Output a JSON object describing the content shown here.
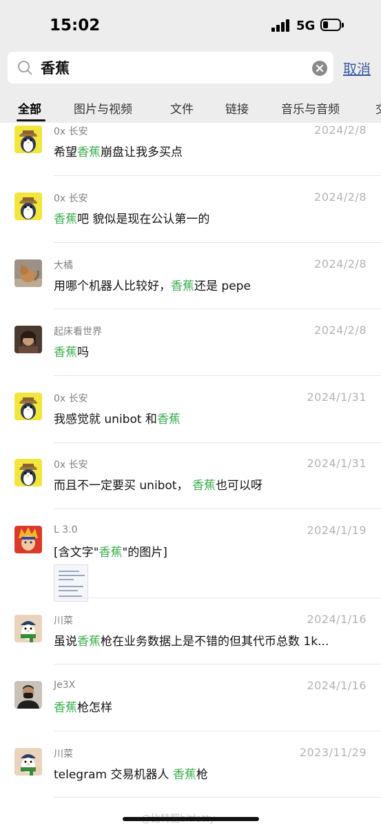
{
  "status_bar": {
    "time": "15:02",
    "network": "5G",
    "battery_level": 0.3
  },
  "search": {
    "query": "香蕉",
    "cancel_label": "取消"
  },
  "tabs": [
    {
      "label": "全部",
      "active": true
    },
    {
      "label": "图片与视频",
      "active": false
    },
    {
      "label": "文件",
      "active": false
    },
    {
      "label": "链接",
      "active": false
    },
    {
      "label": "音乐与音频",
      "active": false
    },
    {
      "label": "交",
      "active": false
    }
  ],
  "results": [
    {
      "sender": "0x 长安",
      "date": "2024/2/8",
      "avatar": "penguin-yellow-icon",
      "parts": [
        [
          "希望",
          false
        ],
        [
          "香蕉",
          true
        ],
        [
          "崩盘让我多买点",
          false
        ]
      ]
    },
    {
      "sender": "0x 长安",
      "date": "2024/2/8",
      "avatar": "penguin-yellow-icon",
      "parts": [
        [
          "香蕉",
          true
        ],
        [
          "吧 貌似是现在公认第一的",
          false
        ]
      ]
    },
    {
      "sender": "大橘",
      "date": "2024/2/8",
      "avatar": "cat-photo-icon",
      "parts": [
        [
          "用哪个机器人比较好，",
          false
        ],
        [
          "香蕉",
          true
        ],
        [
          "还是 pepe",
          false
        ]
      ]
    },
    {
      "sender": "起床看世界",
      "date": "2024/2/8",
      "avatar": "portrait-photo-icon",
      "parts": [
        [
          "香蕉",
          true
        ],
        [
          "吗",
          false
        ]
      ]
    },
    {
      "sender": "0x 长安",
      "date": "2024/1/31",
      "avatar": "penguin-yellow-icon",
      "parts": [
        [
          "我感觉就 unibot 和",
          false
        ],
        [
          "香蕉",
          true
        ]
      ]
    },
    {
      "sender": "0x 长安",
      "date": "2024/1/31",
      "avatar": "penguin-yellow-icon",
      "parts": [
        [
          "而且不一定要买 unibot，  ",
          false
        ],
        [
          "香蕉",
          true
        ],
        [
          "也可以呀",
          false
        ]
      ]
    },
    {
      "sender": "L 3.0",
      "date": "2024/1/19",
      "avatar": "anime-character-icon",
      "parts": [
        [
          "[含文字\"",
          false
        ],
        [
          "香蕉",
          true
        ],
        [
          "\"的图片]",
          false
        ]
      ],
      "has_image": true
    },
    {
      "sender": "川菜",
      "date": "2024/1/16",
      "avatar": "penguin-scarf-icon",
      "parts": [
        [
          "虽说",
          false
        ],
        [
          "香蕉",
          true
        ],
        [
          "枪在业务数据上是不错的但其代币总数 1k...",
          false
        ]
      ]
    },
    {
      "sender": "Je3X",
      "date": "2024/1/16",
      "avatar": "person-masked-icon",
      "parts": [
        [
          "香蕉",
          true
        ],
        [
          "枪怎样",
          false
        ]
      ]
    },
    {
      "sender": "川菜",
      "date": "2023/11/29",
      "avatar": "penguin-scarf-icon",
      "parts": [
        [
          "telegram 交易机器人 ",
          false
        ],
        [
          "香蕉",
          true
        ],
        [
          "枪",
          false
        ]
      ]
    }
  ],
  "watermark": "@比特肥bitfatty",
  "colors": {
    "highlight": "#3dad4f",
    "link": "#3a5b9f",
    "header_bg": "#ededed"
  }
}
